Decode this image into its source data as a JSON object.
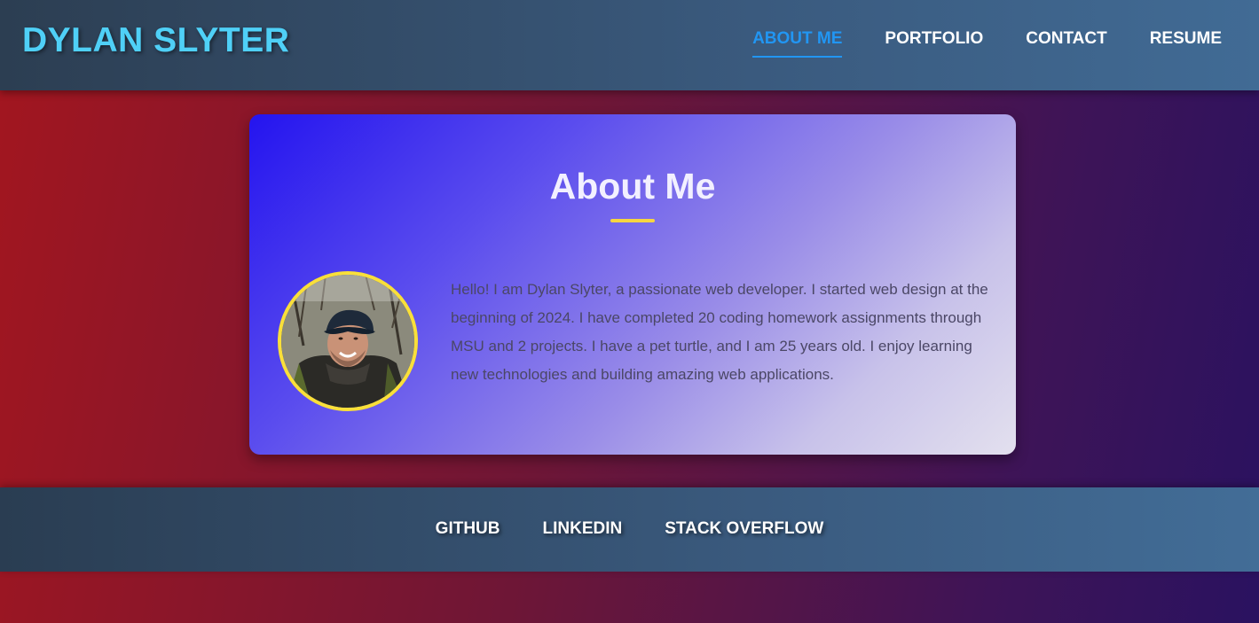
{
  "header": {
    "logo": "DYLAN SLYTER",
    "nav": [
      {
        "label": "ABOUT ME",
        "active": true
      },
      {
        "label": "PORTFOLIO",
        "active": false
      },
      {
        "label": "CONTACT",
        "active": false
      },
      {
        "label": "RESUME",
        "active": false
      }
    ]
  },
  "about": {
    "title": "About Me",
    "bio": "Hello! I am Dylan Slyter, a passionate web developer. I started web design at the beginning of 2024. I have completed 20 coding homework assignments through MSU and 2 projects. I have a pet turtle, and I am 25 years old. I enjoy learning new technologies and building amazing web applications."
  },
  "footer": {
    "links": [
      "GITHUB",
      "LINKEDIN",
      "STACK OVERFLOW"
    ]
  },
  "colors": {
    "accent": "#4fd0f7",
    "active_nav": "#2196f3",
    "underline": "#f7d640",
    "avatar_border": "#f9df3a"
  }
}
